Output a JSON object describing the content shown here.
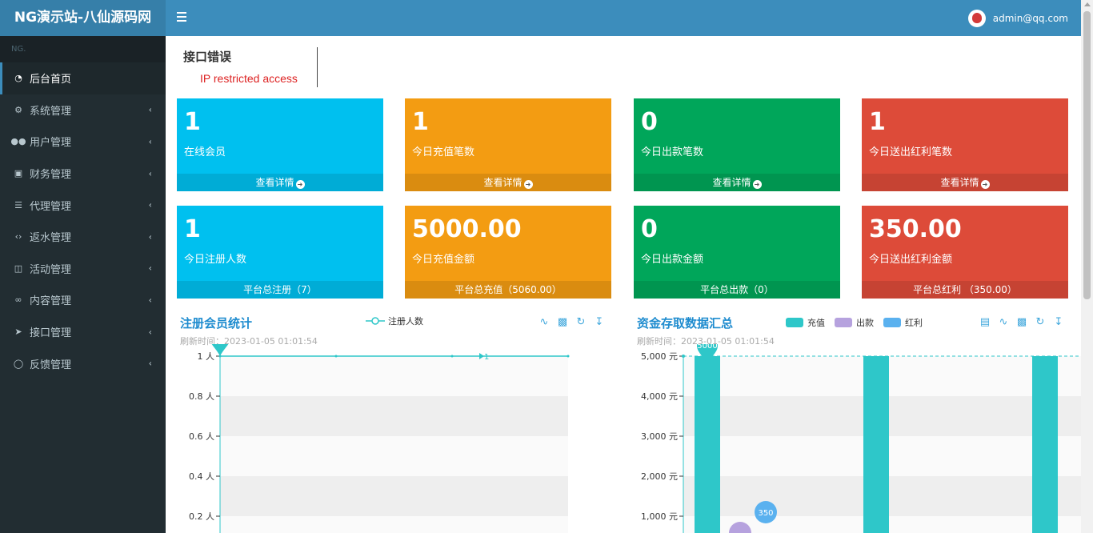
{
  "header": {
    "logo": "NG演示站-八仙源码网",
    "user_email": "admin@qq.com"
  },
  "sidebar": {
    "header": "NG.",
    "items": [
      {
        "label": "后台首页",
        "icon": "dashboard-icon",
        "active": true
      },
      {
        "label": "系统管理",
        "icon": "gear-icon"
      },
      {
        "label": "用户管理",
        "icon": "users-icon"
      },
      {
        "label": "财务管理",
        "icon": "money-icon"
      },
      {
        "label": "代理管理",
        "icon": "list-icon"
      },
      {
        "label": "返水管理",
        "icon": "code-icon"
      },
      {
        "label": "活动管理",
        "icon": "map-icon"
      },
      {
        "label": "内容管理",
        "icon": "link-icon"
      },
      {
        "label": "接口管理",
        "icon": "paper-plane-icon"
      },
      {
        "label": "反馈管理",
        "icon": "comment-icon"
      }
    ]
  },
  "error": {
    "title": "接口错误",
    "message": "IP restricted access"
  },
  "boxes": [
    {
      "num": "1",
      "label": "在线会员",
      "footer": "查看详情",
      "color": "#00c0ef"
    },
    {
      "num": "1",
      "label": "今日充值笔数",
      "footer": "查看详情",
      "color": "#f39c12"
    },
    {
      "num": "0",
      "label": "今日出款笔数",
      "footer": "查看详情",
      "color": "#00a65a"
    },
    {
      "num": "1",
      "label": "今日送出红利笔数",
      "footer": "查看详情",
      "color": "#dd4b39"
    },
    {
      "num": "1",
      "label": "今日注册人数",
      "footer": "平台总注册（7）",
      "color": "#00c0ef"
    },
    {
      "num": "5000.00",
      "label": "今日充值金额",
      "footer": "平台总充值（5060.00）",
      "color": "#f39c12"
    },
    {
      "num": "0",
      "label": "今日出款金额",
      "footer": "平台总出款（0）",
      "color": "#00a65a"
    },
    {
      "num": "350.00",
      "label": "今日送出红利金额",
      "footer": "平台总红利 （350.00）",
      "color": "#dd4b39"
    }
  ],
  "chart1": {
    "title": "注册会员统计",
    "subtitle": "刷新时间：2023-01-05 01:01:54",
    "legend": "注册人数"
  },
  "chart2": {
    "title": "资金存取数据汇总",
    "subtitle": "刷新时间：2023-01-05 01:01:54"
  },
  "chart_data": [
    {
      "type": "line",
      "title": "注册会员统计",
      "series": [
        {
          "name": "注册人数",
          "values": [
            1,
            1,
            1,
            1
          ]
        }
      ],
      "ylim": [
        0,
        1
      ],
      "y_ticks": [
        "1 人",
        "0.8 人",
        "0.6 人",
        "0.4 人",
        "0.2 人"
      ],
      "y_tick_values": [
        1,
        0.8,
        0.6,
        0.4,
        0.2
      ],
      "mark_point": "1",
      "mark_line": "1",
      "grid": true,
      "legend_position": "top-center"
    },
    {
      "type": "bar",
      "title": "资金存取数据汇总",
      "groups": 3,
      "series": [
        {
          "name": "充值",
          "values": [
            5000,
            5000,
            5000
          ],
          "color": "#2ec7c9"
        },
        {
          "name": "出款",
          "values": [
            0,
            0,
            0
          ],
          "color": "#b6a2de"
        },
        {
          "name": "红利",
          "values": [
            350,
            0,
            0
          ],
          "color": "#5ab1ef"
        }
      ],
      "ylim": [
        0,
        5000
      ],
      "y_ticks": [
        "5,000 元",
        "4,000 元",
        "3,000 元",
        "2,000 元",
        "1,000 元"
      ],
      "y_tick_values": [
        5000,
        4000,
        3000,
        2000,
        1000
      ],
      "mark_point_max": "5000",
      "mark_point_bonus": "350",
      "mark_line": "5000",
      "grid": true,
      "legend_position": "top-center"
    }
  ]
}
